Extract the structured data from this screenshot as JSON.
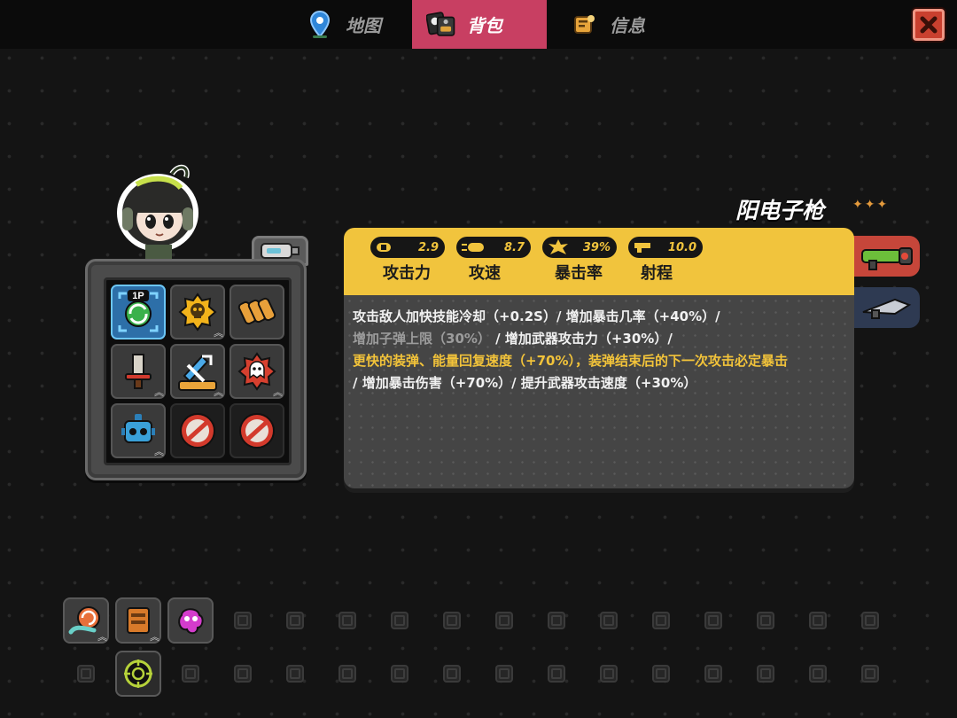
{
  "tabs": [
    {
      "label": "地图",
      "icon": "map-pin-icon"
    },
    {
      "label": "背包",
      "icon": "backpack-icon",
      "active": true
    },
    {
      "label": "信息",
      "icon": "info-scroll-icon"
    }
  ],
  "close_icon": "close-icon",
  "weapon": {
    "name": "阳电子枪",
    "stars": "✦✦✦",
    "rarity": 3
  },
  "stats": [
    {
      "label": "攻击力",
      "value": "2.9",
      "icon": "bullet-damage-icon"
    },
    {
      "label": "攻速",
      "value": "8.7",
      "icon": "bullet-speed-icon"
    },
    {
      "label": "暴击率",
      "value": "39%",
      "icon": "crit-burst-icon"
    },
    {
      "label": "射程",
      "value": "10.0",
      "icon": "range-gun-icon"
    }
  ],
  "description": {
    "line1": "攻击敌人加快技能冷却（+0.2S）/ 增加暴击几率（+40%）/",
    "line2_dim": "增加子弹上限（30%）",
    "line2": "/ 增加武器攻击力（+30%）/",
    "line3": "更快的装弹、能量回复速度（+70%），装弹结束后的下一次攻击必定暴击",
    "line4": "/ 增加暴击伤害（+70%）/ 提升武器攻击速度（+30%）"
  },
  "loadout": {
    "badge": "1P",
    "slot_icons": [
      "recharge-cycle-icon",
      "skull-badge-icon",
      "ammo-belt-icon",
      "sword-icon",
      "arrow-shield-icon",
      "ghost-badge-icon",
      "robot-head-icon",
      "empty-slot-icon",
      "empty-slot-icon"
    ]
  },
  "inventory": {
    "items": [
      "snail-shell-icon",
      "crate-icon",
      "pink-splat-icon",
      "crosshair-icon"
    ]
  },
  "colors": {
    "accent_pink": "#c83f62",
    "stat_yellow": "#f1c43d",
    "highlight_text": "#f2c33a",
    "close_red": "#c9402f"
  }
}
